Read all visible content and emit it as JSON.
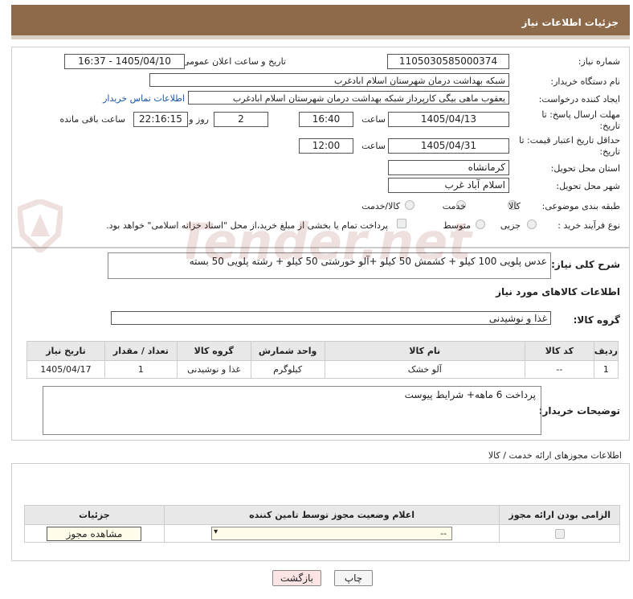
{
  "page_title": "جزئیات اطلاعات نیاز",
  "fields": {
    "need_number_label": "شماره نیاز:",
    "need_number": "1105030585000374",
    "announce_label": "تاریخ و ساعت اعلان عمومی:",
    "announce_value": "1405/04/10 - 16:37",
    "buyer_org_label": "نام دستگاه خریدار:",
    "buyer_org": "شبکه بهداشت درمان شهرستان اسلام ابادغرب",
    "requester_label": "ایجاد کننده درخواست:",
    "requester": "یعقوب ماهی بیگی کارپرداز شبکه بهداشت درمان شهرستان اسلام ابادغرب",
    "contact_link": "اطلاعات تماس خریدار",
    "deadline_label": "مهلت ارسال پاسخ: تا تاریخ:",
    "deadline_date": "1405/04/13",
    "time_label": "ساعت",
    "deadline_time": "16:40",
    "days_value": "2",
    "days_label": "روز و",
    "remaining_time": "22:16:15",
    "remaining_label": "ساعت باقی مانده",
    "min_price_label": "حداقل تاریخ اعتبار قیمت: تا تاریخ:",
    "min_price_date": "1405/04/31",
    "min_price_time": "12:00",
    "province_label": "استان محل تحویل:",
    "province": "کرمانشاه",
    "city_label": "شهر محل تحویل:",
    "city": "اسلام آباد غرب",
    "category_label": "طبقه بندی موضوعی:",
    "category_options": [
      "کالا",
      "خدمت",
      "کالا/خدمت"
    ],
    "process_label": "نوع فرآیند خرید :",
    "process_options": [
      "جزیی",
      "متوسط"
    ],
    "payment_note": "پرداخت تمام یا بخشی از مبلغ خرید،از محل \"اسناد خزانه اسلامی\" خواهد بود."
  },
  "description": {
    "label": "شرح کلی نیاز:",
    "text": "عدس پلویی 100 کیلو  + کشمش 50 کیلو  +آلو خورشتی 50 کیلو + رشته پلویی 50 بسته"
  },
  "goods": {
    "section_title": "اطلاعات کالاهای مورد نیاز",
    "group_label": "گروه کالا:",
    "group_value": "غذا و نوشیدنی",
    "columns": [
      "ردیف",
      "کد کالا",
      "نام کالا",
      "واحد شمارش",
      "گروه کالا",
      "تعداد / مقدار",
      "تاریخ نیاز"
    ],
    "rows": [
      {
        "idx": "1",
        "code": "--",
        "name": "آلو خشک",
        "unit": "کیلوگرم",
        "group": "غذا و نوشیدنی",
        "qty": "1",
        "date": "1405/04/17"
      }
    ]
  },
  "buyer_notes": {
    "label": "توضیحات خریدار:",
    "text": "پرداخت 6 ماهه+ شرایط پیوست"
  },
  "permits": {
    "section_title": "اطلاعات مجوزهای ارائه خدمت / کالا",
    "columns": [
      "الزامی بودن ارائه مجوز",
      "اعلام وضعیت مجوز توسط تامین کننده",
      "جزئیات"
    ],
    "select_value": "--",
    "view_button": "مشاهده مجوز"
  },
  "buttons": {
    "print": "چاپ",
    "back": "بازگشت"
  },
  "watermark": "AriaTender.net"
}
